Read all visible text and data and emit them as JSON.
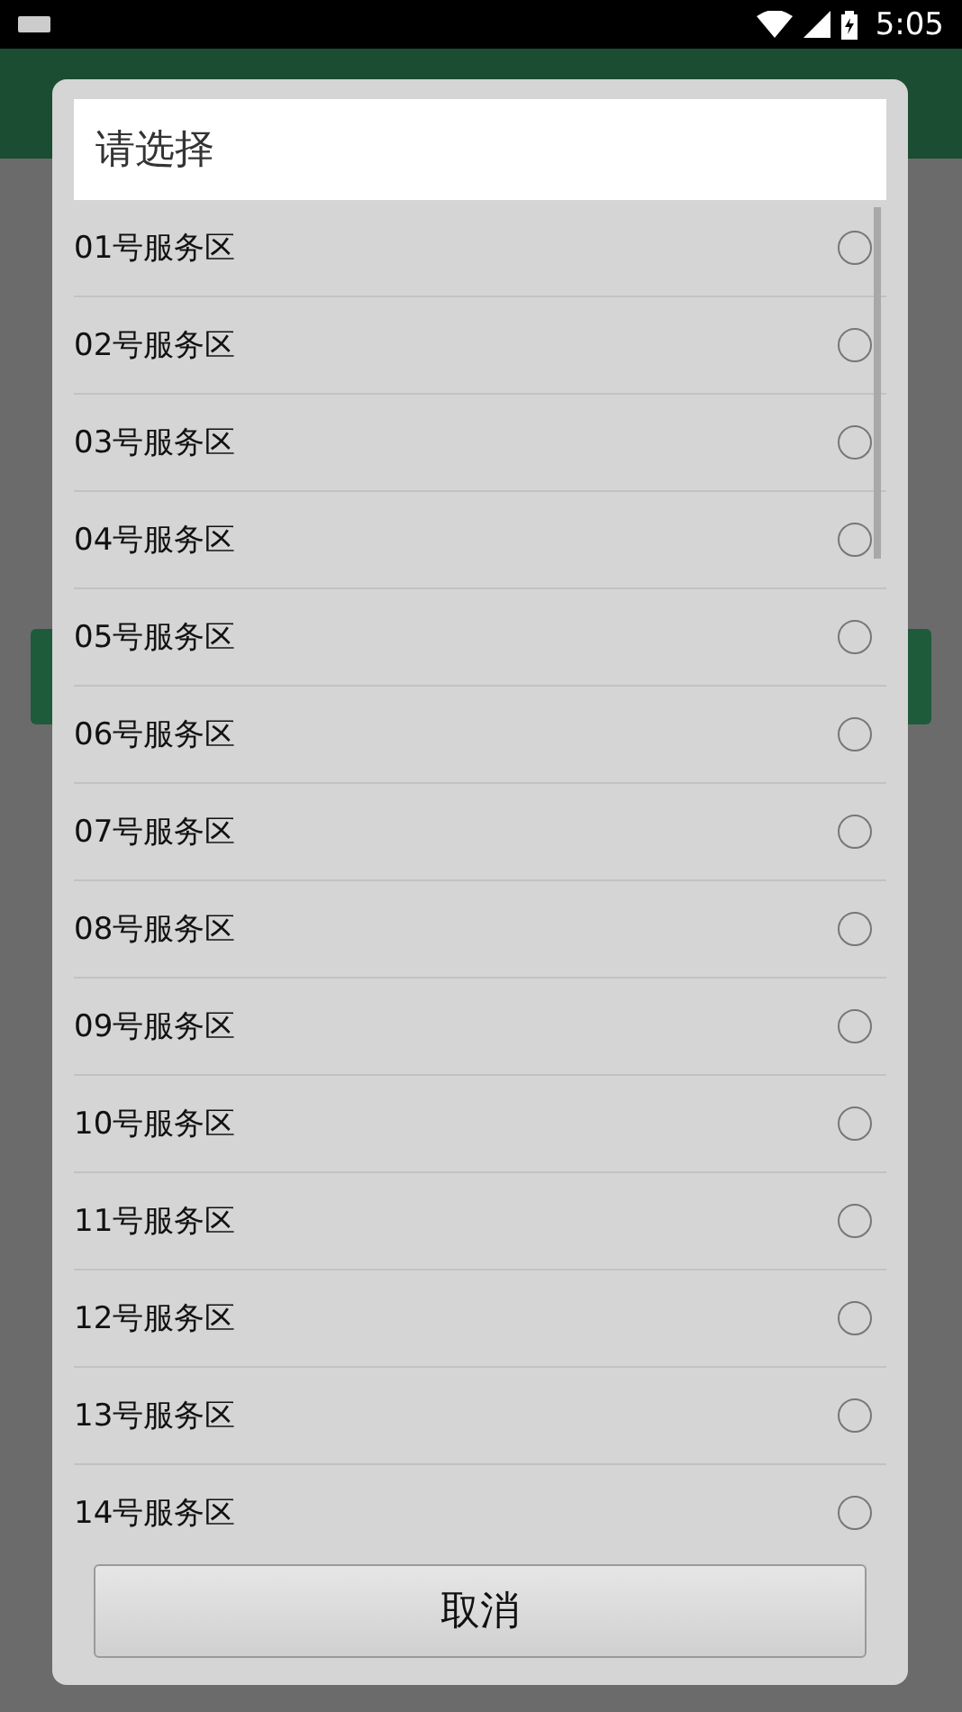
{
  "status_bar": {
    "time": "5:05"
  },
  "dialog": {
    "title": "请选择",
    "options": [
      {
        "label": "01号服务区",
        "selected": false
      },
      {
        "label": "02号服务区",
        "selected": false
      },
      {
        "label": "03号服务区",
        "selected": false
      },
      {
        "label": "04号服务区",
        "selected": false
      },
      {
        "label": "05号服务区",
        "selected": false
      },
      {
        "label": "06号服务区",
        "selected": false
      },
      {
        "label": "07号服务区",
        "selected": false
      },
      {
        "label": "08号服务区",
        "selected": false
      },
      {
        "label": "09号服务区",
        "selected": false
      },
      {
        "label": "10号服务区",
        "selected": false
      },
      {
        "label": "11号服务区",
        "selected": false
      },
      {
        "label": "12号服务区",
        "selected": false
      },
      {
        "label": "13号服务区",
        "selected": false
      },
      {
        "label": "14号服务区",
        "selected": false
      }
    ],
    "cancel_button": "取消"
  }
}
